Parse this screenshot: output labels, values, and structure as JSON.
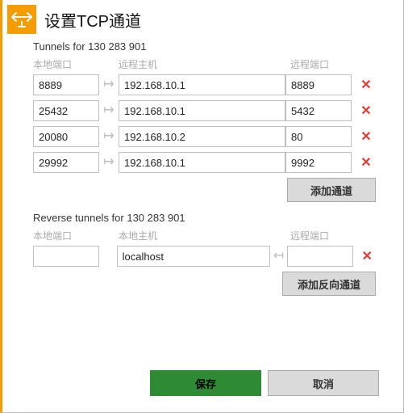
{
  "header": {
    "title": "设置TCP通道"
  },
  "tunnels": {
    "label": "Tunnels for 130 283 901",
    "columns": {
      "local": "本地端口",
      "host": "远程主机",
      "remote": "远程端口"
    },
    "rows": [
      {
        "local": "8889",
        "host": "192.168.10.1",
        "remote": "8889"
      },
      {
        "local": "25432",
        "host": "192.168.10.1",
        "remote": "5432"
      },
      {
        "local": "20080",
        "host": "192.168.10.2",
        "remote": "80"
      },
      {
        "local": "29992",
        "host": "192.168.10.1",
        "remote": "9992"
      }
    ],
    "add_label": "添加通道"
  },
  "reverse": {
    "label": "Reverse tunnels for 130 283 901",
    "columns": {
      "local": "本地端口",
      "host": "本地主机",
      "remote": "远程端口"
    },
    "rows": [
      {
        "local": "",
        "host": "localhost",
        "remote": ""
      }
    ],
    "add_label": "添加反向通道"
  },
  "footer": {
    "save": "保存",
    "cancel": "取消"
  },
  "icons": {
    "arrow_right": "↦",
    "arrow_left": "↤",
    "delete": "✕"
  },
  "colors": {
    "accent": "#f59c00",
    "primary": "#2e8b33",
    "delete": "#e53935"
  }
}
